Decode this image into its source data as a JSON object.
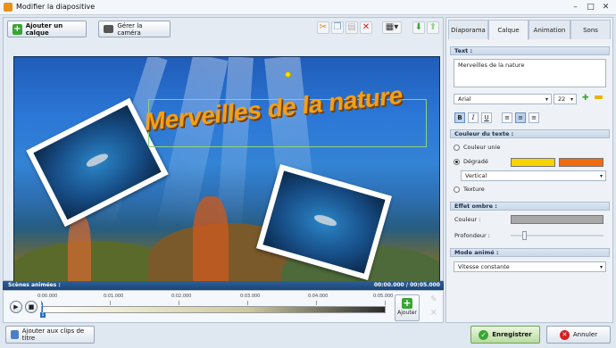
{
  "window": {
    "title": "Modifier la diapositive",
    "minimize": "–",
    "maximize": "□",
    "close": "✕"
  },
  "toolbar": {
    "add_layer_label": "Ajouter un calque",
    "camera_label": "Gérer la caméra"
  },
  "canvas": {
    "title_text": "Merveilles de la nature"
  },
  "scenes": {
    "header": "Scènes animées :",
    "time": "00:00.000 / 00:05.000",
    "ticks": [
      "0:00.000",
      "0:01.000",
      "0:02.000",
      "0:03.000",
      "0:04.000",
      "0:05.000"
    ],
    "play_icon": "play-icon",
    "stop_icon": "stop-icon",
    "marker": "1",
    "add_label": "Ajouter"
  },
  "tabs": [
    "Diaporama",
    "Calque",
    "Animation",
    "Sons"
  ],
  "active_tab": "Calque",
  "text_section": {
    "header": "Text :",
    "value": "Merveilles de la nature",
    "font": "Arial",
    "size": "22"
  },
  "color_section": {
    "header": "Couleur du texte :",
    "opt_solid": "Couleur unie",
    "opt_gradient": "Dégradé",
    "gradient_dir": "Vertical",
    "opt_texture": "Texture",
    "color1": "#f8d300",
    "color2": "#f06a0e"
  },
  "shadow_section": {
    "header": "Effet ombre :",
    "color_label": "Couleur :",
    "depth_label": "Profondeur :",
    "shadow_color": "#a8a8a8"
  },
  "anim_section": {
    "header": "Mode animé :",
    "value": "Vitesse constante"
  },
  "bottom": {
    "add_title_clips": "Ajouter aux clips de titre",
    "save": "Enregistrer",
    "cancel": "Annuler"
  }
}
